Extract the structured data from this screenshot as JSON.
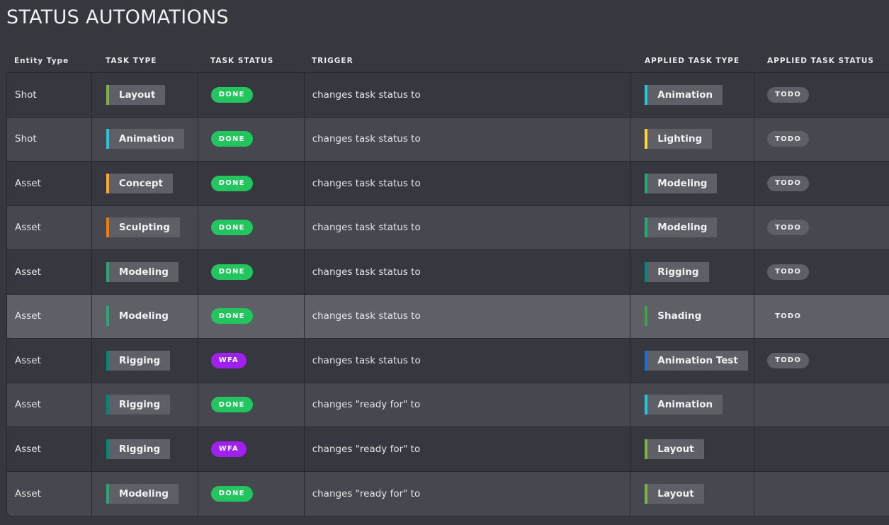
{
  "page": {
    "title": "STATUS AUTOMATIONS"
  },
  "table": {
    "headers": [
      "Entity Type",
      "TASK TYPE",
      "TASK STATUS",
      "TRIGGER",
      "APPLIED TASK TYPE",
      "APPLIED TASK STATUS"
    ],
    "rows": [
      {
        "entity": "Shot",
        "task_type": "Layout",
        "task_type_color": "#7cb342",
        "status": "DONE",
        "status_kind": "done",
        "trigger": "changes task status to",
        "applied_type": "Animation",
        "applied_type_color": "#26c6da",
        "applied_status": "TODO"
      },
      {
        "entity": "Shot",
        "task_type": "Animation",
        "task_type_color": "#26c6da",
        "status": "DONE",
        "status_kind": "done",
        "trigger": "changes task status to",
        "applied_type": "Lighting",
        "applied_type_color": "#fdd835",
        "applied_status": "TODO"
      },
      {
        "entity": "Asset",
        "task_type": "Concept",
        "task_type_color": "#ffa726",
        "status": "DONE",
        "status_kind": "done",
        "trigger": "changes task status to",
        "applied_type": "Modeling",
        "applied_type_color": "#26a96c",
        "applied_status": "TODO"
      },
      {
        "entity": "Asset",
        "task_type": "Sculpting",
        "task_type_color": "#f57c00",
        "status": "DONE",
        "status_kind": "done",
        "trigger": "changes task status to",
        "applied_type": "Modeling",
        "applied_type_color": "#26a96c",
        "applied_status": "TODO"
      },
      {
        "entity": "Asset",
        "task_type": "Modeling",
        "task_type_color": "#26a96c",
        "status": "DONE",
        "status_kind": "done",
        "trigger": "changes task status to",
        "applied_type": "Rigging",
        "applied_type_color": "#00897b",
        "applied_status": "TODO"
      },
      {
        "entity": "Asset",
        "task_type": "Modeling",
        "task_type_color": "#26a96c",
        "status": "DONE",
        "status_kind": "done",
        "trigger": "changes task status to",
        "applied_type": "Shading",
        "applied_type_color": "#43a047",
        "applied_status": "TODO",
        "hover": true
      },
      {
        "entity": "Asset",
        "task_type": "Rigging",
        "task_type_color": "#00897b",
        "status": "WFA",
        "status_kind": "wfa",
        "trigger": "changes task status to",
        "applied_type": "Animation Test",
        "applied_type_color": "#1e6fcf",
        "applied_status": "TODO"
      },
      {
        "entity": "Asset",
        "task_type": "Rigging",
        "task_type_color": "#00897b",
        "status": "DONE",
        "status_kind": "done",
        "trigger": "changes \"ready for\" to",
        "applied_type": "Animation",
        "applied_type_color": "#26c6da",
        "applied_status": ""
      },
      {
        "entity": "Asset",
        "task_type": "Rigging",
        "task_type_color": "#00897b",
        "status": "WFA",
        "status_kind": "wfa",
        "trigger": "changes \"ready for\" to",
        "applied_type": "Layout",
        "applied_type_color": "#7cb342",
        "applied_status": ""
      },
      {
        "entity": "Asset",
        "task_type": "Modeling",
        "task_type_color": "#26a96c",
        "status": "DONE",
        "status_kind": "done",
        "trigger": "changes \"ready for\" to",
        "applied_type": "Layout",
        "applied_type_color": "#7cb342",
        "applied_status": ""
      }
    ]
  }
}
